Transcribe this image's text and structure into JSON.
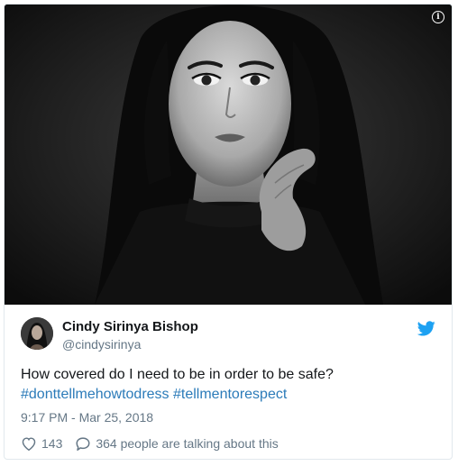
{
  "media": {
    "info_icon": "info-icon",
    "alt": "Black and white portrait photo of a woman with dark hair, hand near chin"
  },
  "author": {
    "name": "Cindy Sirinya Bishop",
    "handle": "@cindysirinya",
    "avatar_icon": "avatar"
  },
  "brand": {
    "icon": "twitter-bird-icon",
    "color": "#1da1f2"
  },
  "tweet": {
    "text": "How covered do I need to be in order to be safe?",
    "hashtag_1": "#donttellmehowtodress",
    "hashtag_2": "#tellmentorespect",
    "hashtag_color": "#2b7bb9",
    "timestamp": "9:17 PM - Mar 25, 2018"
  },
  "actions": {
    "like_icon": "heart-icon",
    "like_count": "143",
    "reply_icon": "speech-bubble-icon",
    "reply_text": "364 people are talking about this"
  }
}
